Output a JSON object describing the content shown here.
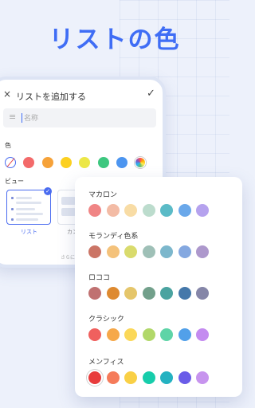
{
  "headline": "リストの色",
  "phone": {
    "header": {
      "close_icon": "×",
      "title": "リストを追加する",
      "confirm_icon": "✓"
    },
    "name_input": {
      "placeholder": "名称"
    },
    "color_section": {
      "label": "色",
      "swatches": [
        "none",
        "#f36a6a",
        "#f6a239",
        "#fcd021",
        "#ece747",
        "#3dc77f",
        "#4c95f0",
        "rainbow"
      ]
    },
    "view_section": {
      "label": "ビュー",
      "options": [
        "リスト",
        "カン"
      ]
    },
    "more_text": "さらに"
  },
  "palette": {
    "groups": [
      {
        "name": "マカロン",
        "colors": [
          "#f08585",
          "#f3bba5",
          "#f8dca5",
          "#bcdccd",
          "#5bbbc7",
          "#6aa8ea",
          "#b5a2ee"
        ]
      },
      {
        "name": "モランディ色系",
        "colors": [
          "#cb7566",
          "#f4c27b",
          "#d9db6d",
          "#9fc0b7",
          "#7cb7cc",
          "#84a8e0",
          "#ad98cc"
        ]
      },
      {
        "name": "ロココ",
        "colors": [
          "#c07171",
          "#de8a30",
          "#e5c66b",
          "#72a08b",
          "#4aa3a0",
          "#4578aa",
          "#8586a8"
        ]
      },
      {
        "name": "クラシック",
        "colors": [
          "#f0605e",
          "#f6a84a",
          "#fbd859",
          "#b1d86a",
          "#5ed4a7",
          "#52a0e9",
          "#c48bf0"
        ]
      },
      {
        "name": "メンフィス",
        "colors": [
          "#e83c3c",
          "#f57b5a",
          "#f9d046",
          "#17cdab",
          "#24b2c1",
          "#6a5ce8",
          "#c794ee"
        ]
      }
    ]
  }
}
